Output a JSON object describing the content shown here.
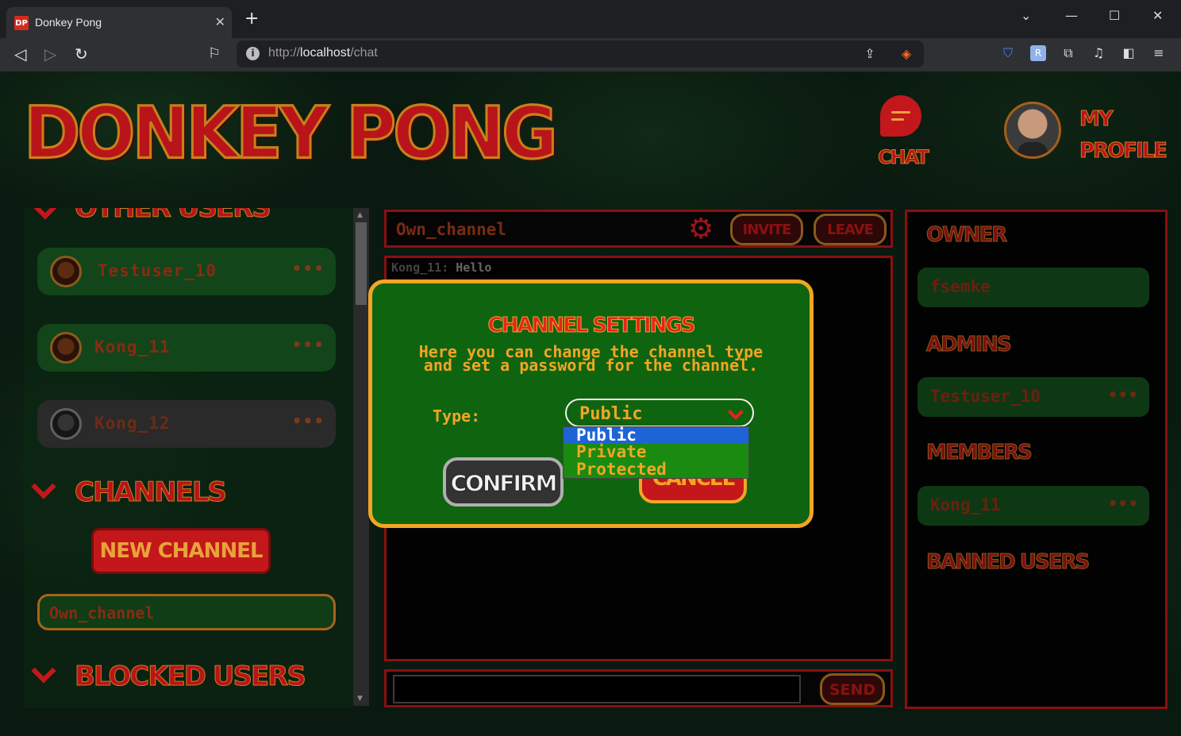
{
  "browser": {
    "tab_title": "Donkey Pong",
    "favicon_text": "DP",
    "url_scheme": "http://",
    "url_host": "localhost",
    "url_path": "/chat"
  },
  "header": {
    "logo": "DONKEY PONG",
    "chat_label": "CHAT",
    "profile_line1": "MY",
    "profile_line2": "PROFILE"
  },
  "left_panel": {
    "other_users_title": "OTHER USERS",
    "users": [
      {
        "name": "Testuser_10",
        "menu": "•••"
      },
      {
        "name": "Kong_11",
        "menu": "•••"
      },
      {
        "name": "Kong_12",
        "menu": "•••"
      }
    ],
    "channels_title": "CHANNELS",
    "new_channel_label": "NEW CHANNEL",
    "channels": [
      "Own_channel"
    ],
    "blocked_title": "BLOCKED USERS"
  },
  "chat": {
    "channel_name": "Own_channel",
    "invite_label": "INVITE",
    "leave_label": "LEAVE",
    "messages": [
      {
        "sender": "Kong_11:",
        "text": "Hello"
      }
    ],
    "send_label": "SEND"
  },
  "right_panel": {
    "owner_title": "OWNER",
    "owner": "fsemke",
    "admins_title": "ADMINS",
    "admins": [
      "Testuser_10"
    ],
    "members_title": "MEMBERS",
    "members": [
      "Kong_11"
    ],
    "banned_title": "BANNED USERS",
    "menu": "•••"
  },
  "modal": {
    "title": "CHANNEL SETTINGS",
    "description": "Here you can change the channel type and set a password for the channel.",
    "type_label": "Type:",
    "selected_type": "Public",
    "options": [
      "Public",
      "Private",
      "Protected"
    ],
    "confirm_label": "CONFIRM",
    "cancel_label": "CANCEL"
  },
  "colors": {
    "brand_red": "#c3171b",
    "brand_orange": "#f2a524",
    "modal_green": "#0f6410",
    "selection_blue": "#1f64d6"
  }
}
